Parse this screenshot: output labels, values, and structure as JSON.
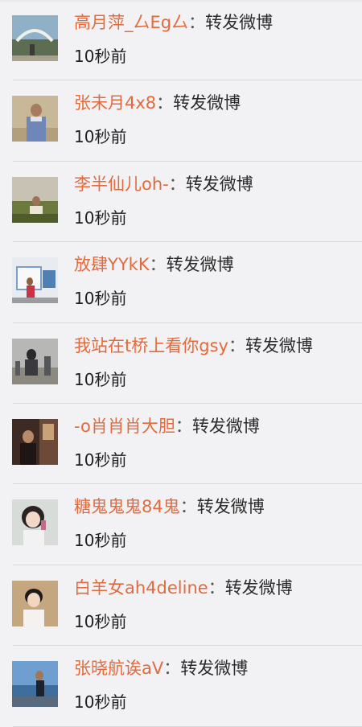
{
  "feed": {
    "items": [
      {
        "username": "高月萍_厶Eg厶",
        "separator": "：",
        "action": "转发微博",
        "time": "10秒前",
        "avatar_icon": "avatar-photo-icon"
      },
      {
        "username": "张未月4x8",
        "separator": "：",
        "action": "转发微博",
        "time": "10秒前",
        "avatar_icon": "avatar-photo-icon"
      },
      {
        "username": "李半仙儿oh-",
        "separator": "：",
        "action": "转发微博",
        "time": "10秒前",
        "avatar_icon": "avatar-photo-icon"
      },
      {
        "username": "放肆YYkK",
        "separator": "：",
        "action": "转发微博",
        "time": "10秒前",
        "avatar_icon": "avatar-photo-icon"
      },
      {
        "username": "我站在t桥上看你gsy",
        "separator": "：",
        "action": "转发微博",
        "time": "10秒前",
        "avatar_icon": "avatar-photo-icon"
      },
      {
        "username": "-o肖肖肖大胆",
        "separator": "：",
        "action": "转发微博",
        "time": "10秒前",
        "avatar_icon": "avatar-photo-icon"
      },
      {
        "username": "糖鬼鬼鬼84鬼",
        "separator": "：",
        "action": "转发微博",
        "time": "10秒前",
        "avatar_icon": "avatar-photo-icon"
      },
      {
        "username": "白羊女ah4deline",
        "separator": "：",
        "action": "转发微博",
        "time": "10秒前",
        "avatar_icon": "avatar-photo-icon"
      },
      {
        "username": "张晓航诶aV",
        "separator": "：",
        "action": "转发微博",
        "time": "10秒前",
        "avatar_icon": "avatar-photo-icon"
      }
    ]
  },
  "colors": {
    "background": "#f2f2f4",
    "username": "#e36a3c",
    "text": "#2b2b2b",
    "divider": "#d9d9dc"
  }
}
